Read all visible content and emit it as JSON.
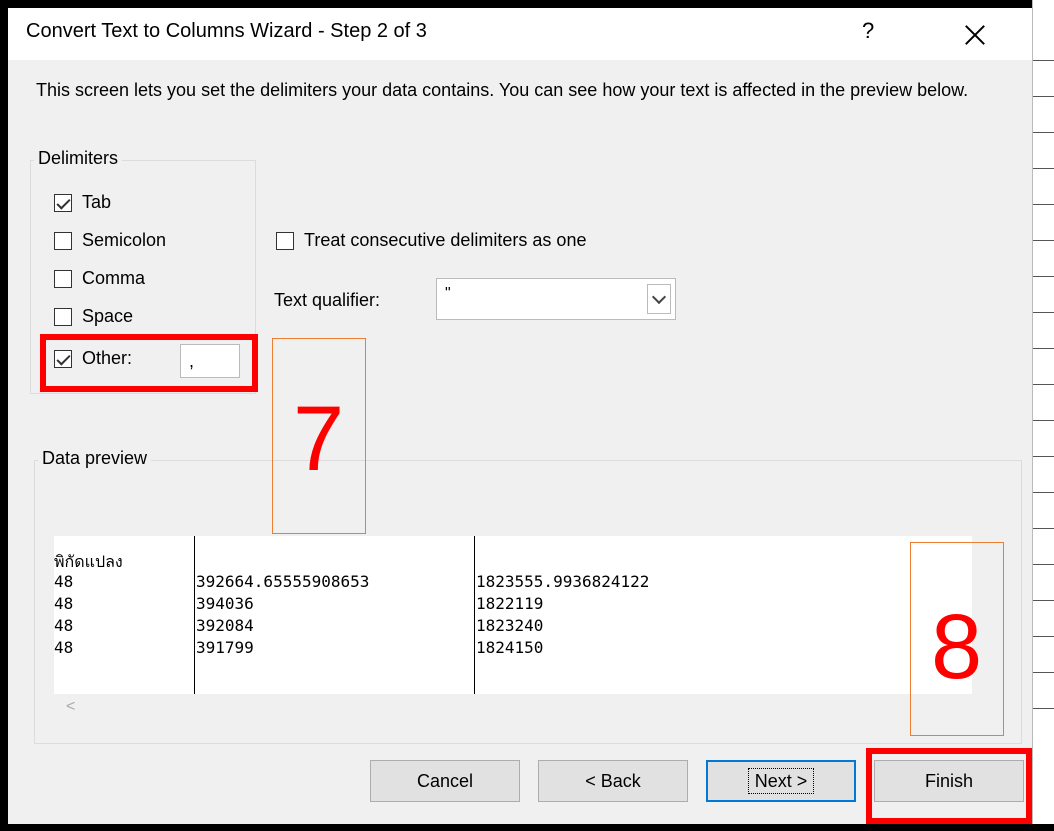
{
  "dialog": {
    "title": "Convert Text to Columns Wizard - Step 2 of 3",
    "help_label": "?",
    "intro": "This screen lets you set the delimiters your data contains.  You can see how your text is affected in the preview below."
  },
  "delimiters": {
    "legend": "Delimiters",
    "options": [
      {
        "label": "Tab",
        "checked": true
      },
      {
        "label": "Semicolon",
        "checked": false
      },
      {
        "label": "Comma",
        "checked": false
      },
      {
        "label": "Space",
        "checked": false
      },
      {
        "label": "Other:",
        "checked": true
      }
    ],
    "other_value": ","
  },
  "consecutive": {
    "label": "Treat consecutive delimiters as one",
    "checked": false
  },
  "qualifier": {
    "label": "Text qualifier:",
    "value": "\""
  },
  "preview": {
    "legend": "Data preview",
    "rows": [
      [
        "พิกัดแปลง",
        "",
        ""
      ],
      [
        "48",
        "392664.65555908653",
        "1823555.9936824122"
      ],
      [
        "48",
        "394036",
        "1822119"
      ],
      [
        "48",
        "392084",
        "1823240"
      ],
      [
        "48",
        "391799",
        "1824150"
      ]
    ],
    "scroll_left": "<"
  },
  "buttons": {
    "cancel": "Cancel",
    "back": "< Back",
    "next": "Next >",
    "finish": "Finish"
  },
  "annotations": {
    "callout_7": "7",
    "callout_8": "8",
    "callout_border_color": "#ed7d31",
    "highlight_color": "#ff0000"
  }
}
